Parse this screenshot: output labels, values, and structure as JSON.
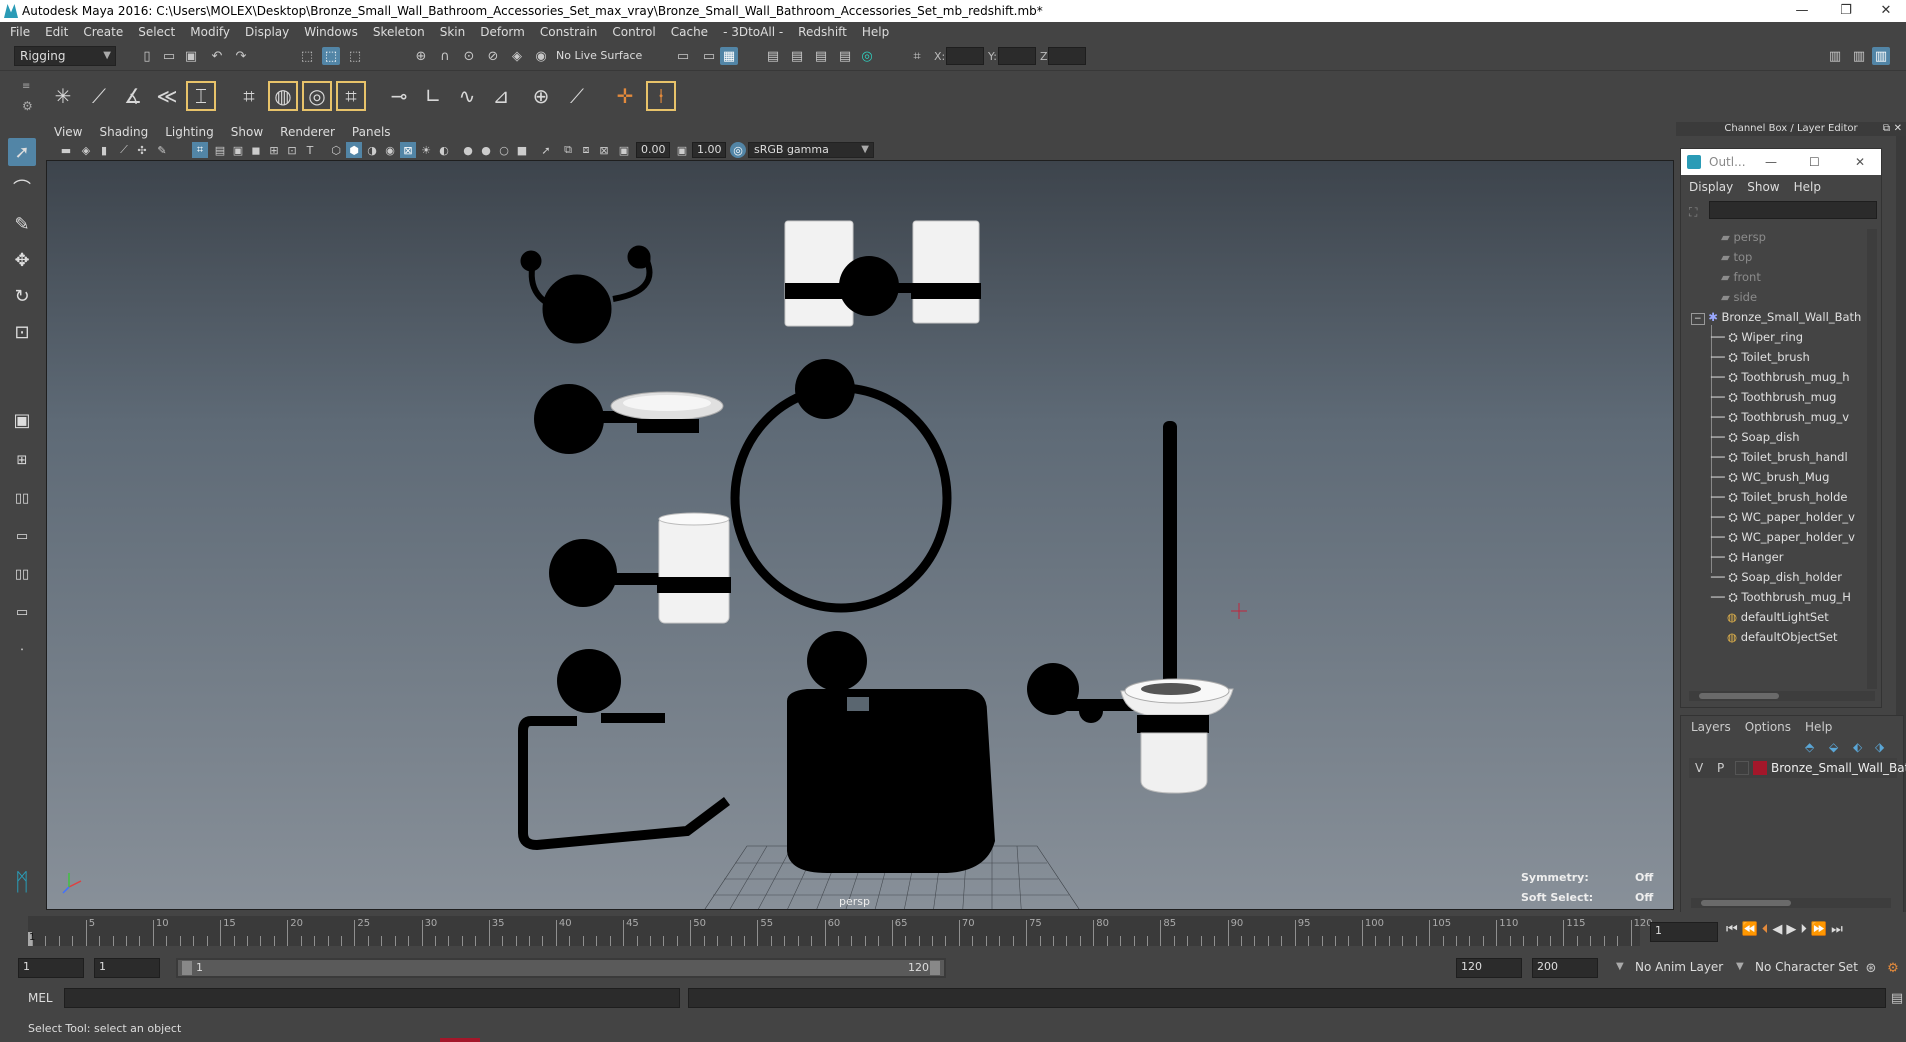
{
  "window": {
    "title": "Autodesk Maya 2016: C:\\Users\\MOLEX\\Desktop\\Bronze_Small_Wall_Bathroom_Accessories_Set_max_vray\\Bronze_Small_Wall_Bathroom_Accessories_Set_mb_redshift.mb*",
    "minimize": "—",
    "restore": "❐",
    "close": "✕"
  },
  "menubar": [
    "File",
    "Edit",
    "Create",
    "Select",
    "Modify",
    "Display",
    "Windows",
    "Skeleton",
    "Skin",
    "Deform",
    "Constrain",
    "Control",
    "Cache",
    "- 3DtoAll -",
    "Redshift",
    "Help"
  ],
  "statusline": {
    "menuset": "Rigging",
    "live_surface": "No Live Surface",
    "x_label": "X:",
    "y_label": "Y:",
    "z_label": "Z:"
  },
  "viewport_menu": [
    "View",
    "Shading",
    "Lighting",
    "Show",
    "Renderer",
    "Panels"
  ],
  "viewport_toolbar": {
    "exposure": "0.00",
    "gamma": "1.00",
    "color_space": "sRGB gamma"
  },
  "viewport": {
    "camera_label": "persp",
    "symmetry_label": "Symmetry:",
    "symmetry_value": "Off",
    "soft_select_label": "Soft Select:",
    "soft_select_value": "Off"
  },
  "channel_box": {
    "title": "Channel Box / Layer Editor"
  },
  "outliner": {
    "title": "Outl...",
    "menu": [
      "Display",
      "Show",
      "Help"
    ],
    "cameras": [
      "persp",
      "top",
      "front",
      "side"
    ],
    "group": "Bronze_Small_Wall_Bath",
    "children": [
      "Wiper_ring",
      "Toilet_brush",
      "Toothbrush_mug_h",
      "Toothbrush_mug",
      "Toothbrush_mug_v",
      "Soap_dish",
      "Toilet_brush_handl",
      "WC_brush_Mug",
      "Toilet_brush_holde",
      "WC_paper_holder_v",
      "WC_paper_holder_v",
      "Hanger",
      "Soap_dish_holder",
      "Toothbrush_mug_H"
    ],
    "sets": [
      "defaultLightSet",
      "defaultObjectSet"
    ]
  },
  "layers": {
    "menu": [
      "Layers",
      "Options",
      "Help"
    ],
    "row": {
      "v": "V",
      "p": "P",
      "name": "Bronze_Small_Wall_Bat",
      "color": "#a3172a"
    }
  },
  "timeline": {
    "ticks": [
      "5",
      "10",
      "15",
      "20",
      "25",
      "30",
      "35",
      "40",
      "45",
      "50",
      "55",
      "60",
      "65",
      "70",
      "75",
      "80",
      "85",
      "90",
      "95",
      "100",
      "105",
      "110",
      "115",
      "120"
    ],
    "current_frame_marker": "1",
    "current_frame_field": "1"
  },
  "range": {
    "start": "1",
    "playback_start": "1",
    "slider_start": "1",
    "slider_end": "120",
    "playback_end": "120",
    "end": "200",
    "anim_layer": "No Anim Layer",
    "character_set": "No Character Set"
  },
  "command_line": {
    "label": "MEL"
  },
  "help_line": "Select Tool: select an object",
  "colors": {
    "accent": "#5285a6",
    "highlight": "#e8c36a",
    "layer_red": "#a3172a"
  }
}
